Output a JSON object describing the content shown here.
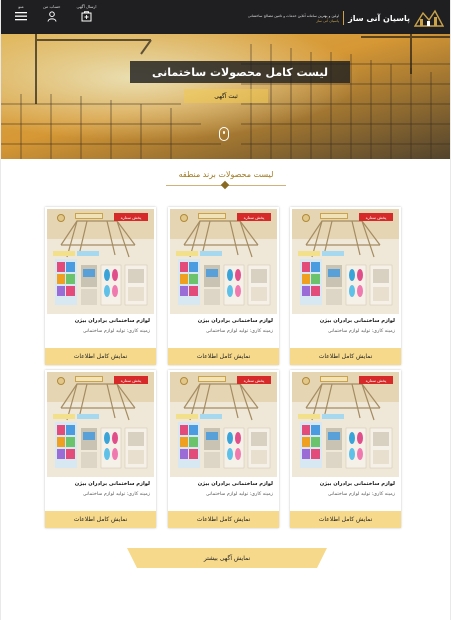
{
  "header": {
    "brand_name": "پاسیان آنی ساز",
    "tagline_1": "اولین و بهترین سامانه آنلاین خدمات و تامین مصالح ساختمانی",
    "tagline_2": "پاسیان آنی ساز",
    "nav": [
      {
        "label": "منو",
        "icon": "hamburger-icon"
      },
      {
        "label": "حساب من",
        "icon": "user-icon"
      },
      {
        "label": "ارسال آگهی",
        "icon": "post-ad-icon"
      }
    ]
  },
  "hero": {
    "title": "لیست کامل محصولات ساختمانی",
    "subtitle": "ثبت آگهی"
  },
  "section": {
    "title": "لیست محصولات برند منطقه"
  },
  "products": [
    {
      "name": "لوازم ساختمانی برادران بیژن",
      "category": "زمینه کاری: تولید لوازم ساختمانی",
      "button": "نمایش کامل اطلاعات",
      "ribbon": "پخش ستاره",
      "col": 0,
      "row": 0
    },
    {
      "name": "لوازم ساختمانی برادران بیژن",
      "category": "زمینه کاری: تولید لوازم ساختمانی",
      "button": "نمایش کامل اطلاعات",
      "ribbon": "پخش ستاره",
      "col": 1,
      "row": 0
    },
    {
      "name": "لوازم ساختمانی برادران بیژن",
      "category": "زمینه کاری: تولید لوازم ساختمانی",
      "button": "نمایش کامل اطلاعات",
      "ribbon": "پخش ستاره",
      "col": 2,
      "row": 0
    },
    {
      "name": "لوازم ساختمانی برادران بیژن",
      "category": "زمینه کاری: تولید لوازم ساختمانی",
      "button": "نمایش کامل اطلاعات",
      "ribbon": "پخش ستاره",
      "col": 0,
      "row": 1
    },
    {
      "name": "لوازم ساختمانی برادران بیژن",
      "category": "زمینه کاری: تولید لوازم ساختمانی",
      "button": "نمایش کامل اطلاعات",
      "ribbon": "پخش ستاره",
      "col": 1,
      "row": 1
    },
    {
      "name": "لوازم ساختمانی برادران بیژن",
      "category": "زمینه کاری: تولید لوازم ساختمانی",
      "button": "نمایش کامل اطلاعات",
      "ribbon": "پخش ستاره",
      "col": 2,
      "row": 1
    }
  ],
  "load_more": {
    "label": "نمایش آگهی بیشتر"
  },
  "colors": {
    "header_bg": "#1f1f22",
    "accent_gold": "#c9a24a",
    "button_yellow": "#f6d98a",
    "ribbon_red": "#d62a2a"
  }
}
